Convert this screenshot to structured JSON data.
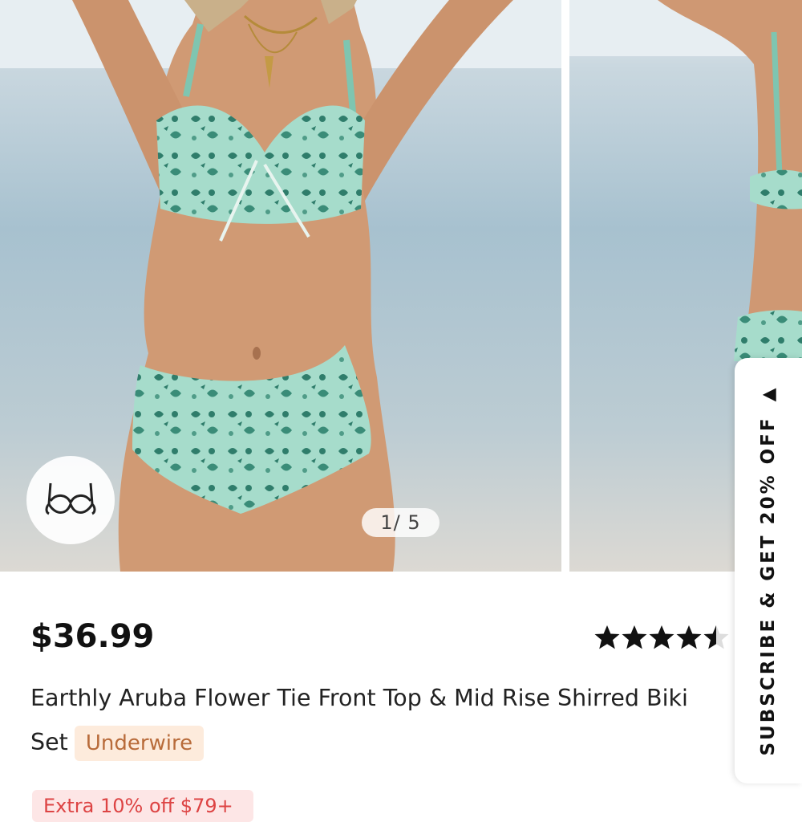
{
  "gallery": {
    "counter": "1/ 5",
    "bra_badge_icon": "underwire-bra-icon"
  },
  "product": {
    "price": "$36.99",
    "rating": 4.5,
    "rating_count": "(",
    "title_line1": "Earthly Aruba Flower Tie Front Top & Mid Rise Shirred Biki",
    "title_line2": "Set",
    "tag": "Underwire"
  },
  "promo": {
    "text": "Extra 10% off $79+"
  },
  "subscribe": {
    "label": "SUBSCRIBE & GET 20% OFF",
    "arrow": "▲"
  },
  "colors": {
    "sky": "#e6edf2",
    "sea": "#a9c4d2",
    "sand": "#dedbd5",
    "swim": "#9fd8c7",
    "print": "#2f7d6b",
    "skin": "#cf9771",
    "tag_bg": "#fdebdc",
    "tag_text": "#b86b3a"
  }
}
